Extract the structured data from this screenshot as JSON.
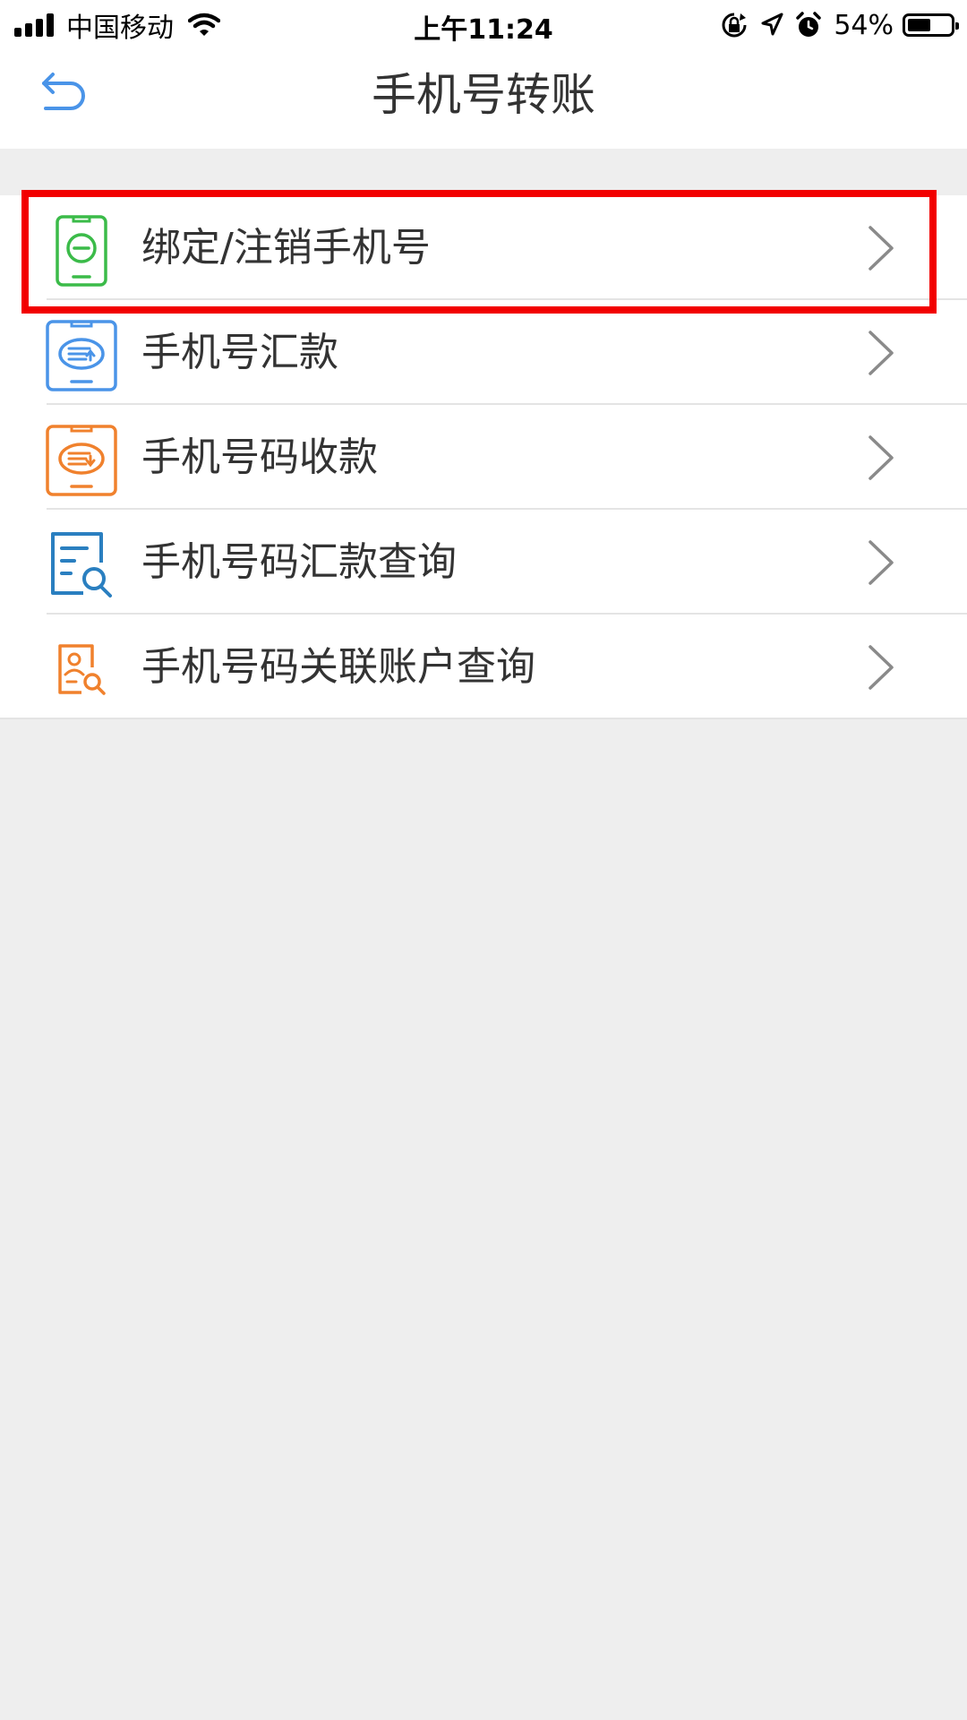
{
  "status_bar": {
    "carrier": "中国移动",
    "time": "上午11:24",
    "battery_percent": "54%",
    "battery_level": 0.54,
    "icons": [
      "signal-icon",
      "wifi-icon",
      "orientation-lock-icon",
      "location-icon",
      "alarm-icon",
      "battery-icon"
    ]
  },
  "nav": {
    "title": "手机号转账",
    "back_icon": "back-arrow-icon"
  },
  "menu": {
    "items": [
      {
        "label": "绑定/注销手机号",
        "icon": "phone-bind-icon",
        "color": "#3bbb49",
        "highlighted": true
      },
      {
        "label": "手机号汇款",
        "icon": "phone-remit-icon",
        "color": "#4a94e8"
      },
      {
        "label": "手机号码收款",
        "icon": "phone-receive-icon",
        "color": "#f0812d"
      },
      {
        "label": "手机号码汇款查询",
        "icon": "document-search-icon",
        "color": "#2a7fc0"
      },
      {
        "label": "手机号码关联账户查询",
        "icon": "account-search-icon",
        "color": "#f0812d"
      }
    ],
    "chevron_icon": "chevron-right-icon"
  },
  "colors": {
    "accent": "#4a94e8",
    "highlight": "#f20000",
    "background": "#eeeeee"
  }
}
